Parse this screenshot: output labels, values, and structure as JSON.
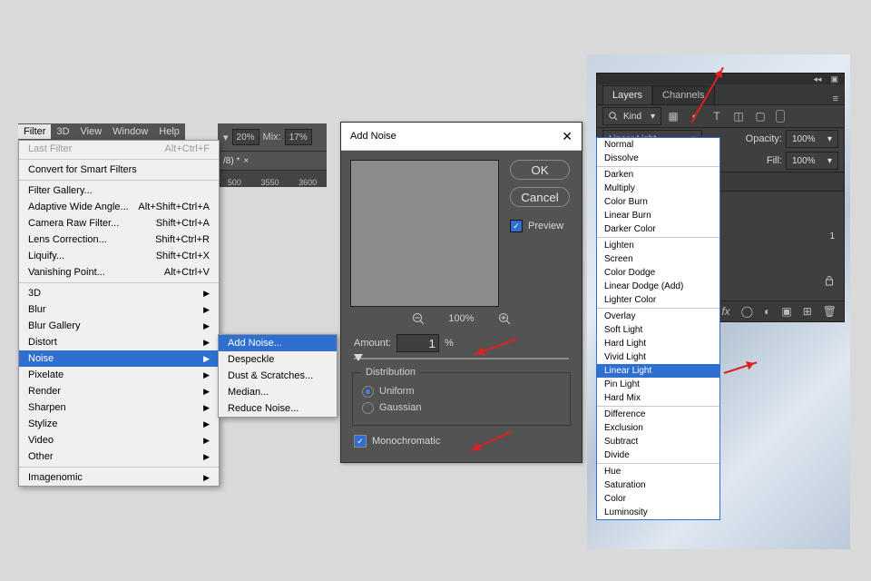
{
  "menubar": {
    "items": [
      "Filter",
      "3D",
      "View",
      "Window",
      "Help"
    ],
    "selected": 0
  },
  "filter_menu": {
    "top": [
      {
        "label": "Last Filter",
        "shortcut": "Alt+Ctrl+F"
      }
    ],
    "sec1": [
      {
        "label": "Convert for Smart Filters",
        "shortcut": ""
      }
    ],
    "sec2": [
      {
        "label": "Filter Gallery...",
        "shortcut": ""
      },
      {
        "label": "Adaptive Wide Angle...",
        "shortcut": "Alt+Shift+Ctrl+A"
      },
      {
        "label": "Camera Raw Filter...",
        "shortcut": "Shift+Ctrl+A"
      },
      {
        "label": "Lens Correction...",
        "shortcut": "Shift+Ctrl+R"
      },
      {
        "label": "Liquify...",
        "shortcut": "Shift+Ctrl+X"
      },
      {
        "label": "Vanishing Point...",
        "shortcut": "Alt+Ctrl+V"
      }
    ],
    "sec3": [
      "3D",
      "Blur",
      "Blur Gallery",
      "Distort",
      "Noise",
      "Pixelate",
      "Render",
      "Sharpen",
      "Stylize",
      "Video",
      "Other"
    ],
    "highlighted": "Noise",
    "sec4": [
      "Imagenomic"
    ]
  },
  "noise_sub": {
    "items": [
      "Add Noise...",
      "Despeckle",
      "Dust & Scratches...",
      "Median...",
      "Reduce Noise..."
    ],
    "highlighted": "Add Noise..."
  },
  "opts_bar": {
    "chips": [
      "20%",
      "Mix:",
      "17%"
    ],
    "tab": "/8) *",
    "ruler": [
      "500",
      "3550",
      "3600"
    ]
  },
  "dialog": {
    "title": "Add Noise",
    "ok": "OK",
    "cancel": "Cancel",
    "preview_label": "Preview",
    "preview_checked": true,
    "zoom_value": "100%",
    "amount_label": "Amount:",
    "amount_value": "1",
    "amount_unit": "%",
    "dist_legend": "Distribution",
    "dist_uniform": "Uniform",
    "dist_gaussian": "Gaussian",
    "dist_selected": "Uniform",
    "mono_label": "Monochromatic",
    "mono_checked": true
  },
  "layers_panel": {
    "tabs": [
      "Layers",
      "Channels"
    ],
    "active": 0,
    "kind_label": "Kind",
    "blend_value": "Linear Light",
    "opacity_label": "Opacity:",
    "opacity_value": "100%",
    "fill_label": "Fill:",
    "fill_value": "100%",
    "layer_number": "1"
  },
  "blend_modes": {
    "groups": [
      [
        "Normal",
        "Dissolve"
      ],
      [
        "Darken",
        "Multiply",
        "Color Burn",
        "Linear Burn",
        "Darker Color"
      ],
      [
        "Lighten",
        "Screen",
        "Color Dodge",
        "Linear Dodge (Add)",
        "Lighter Color"
      ],
      [
        "Overlay",
        "Soft Light",
        "Hard Light",
        "Vivid Light",
        "Linear Light",
        "Pin Light",
        "Hard Mix"
      ],
      [
        "Difference",
        "Exclusion",
        "Subtract",
        "Divide"
      ],
      [
        "Hue",
        "Saturation",
        "Color",
        "Luminosity"
      ]
    ],
    "highlighted": "Linear Light"
  }
}
